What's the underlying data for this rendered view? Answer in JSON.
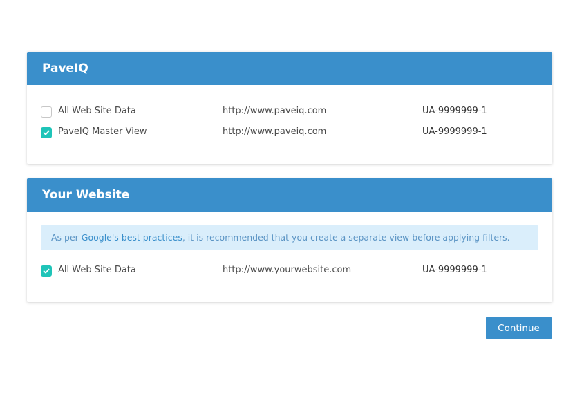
{
  "sections": [
    {
      "title": "PaveIQ",
      "views": [
        {
          "name": "All Web Site Data",
          "url": "http://www.paveiq.com",
          "id": "UA-9999999-1",
          "checked": false
        },
        {
          "name": "PaveIQ Master View",
          "url": "http://www.paveiq.com",
          "id": "UA-9999999-1",
          "checked": true
        }
      ]
    },
    {
      "title": "Your Website",
      "notice": {
        "prefix": "As per ",
        "link_text": "Google's best practices",
        "suffix": ", it is recommended that you create a separate view before applying filters."
      },
      "views": [
        {
          "name": "All Web Site Data",
          "url": "http://www.yourwebsite.com",
          "id": "UA-9999999-1",
          "checked": true
        }
      ]
    }
  ],
  "continue_label": "Continue",
  "colors": {
    "header": "#3a8fcb",
    "checkbox_checked": "#1fc4b8",
    "notice_bg": "#daeefb",
    "button": "#3a8fcb"
  }
}
